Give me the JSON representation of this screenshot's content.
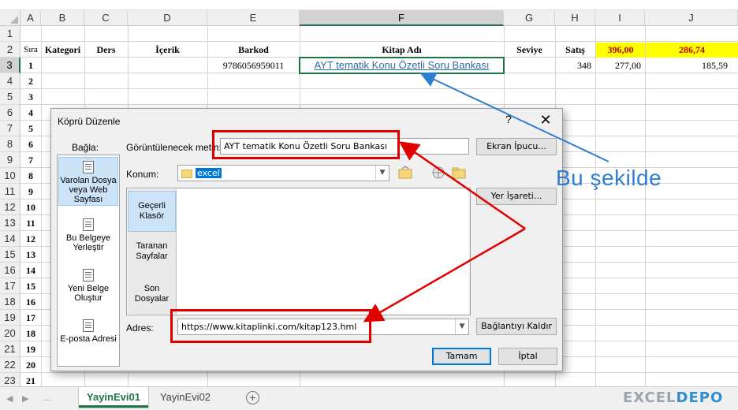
{
  "columns": [
    "A",
    "B",
    "C",
    "D",
    "E",
    "F",
    "G",
    "H",
    "I",
    "J"
  ],
  "selected_column": "F",
  "rows": [
    "1",
    "2",
    "3",
    "4",
    "5",
    "6",
    "7",
    "8",
    "9",
    "10",
    "11",
    "12",
    "13",
    "14",
    "15",
    "16",
    "17",
    "18",
    "19",
    "20",
    "21",
    "22",
    "23"
  ],
  "selected_row": "3",
  "header_row": {
    "sira": "Sıra",
    "kategori": "Kategori",
    "ders": "Ders",
    "icerik": "İçerik",
    "barkod": "Barkod",
    "kitap_adi": "Kitap Adı",
    "seviye": "Seviye",
    "satis": "Satış",
    "i_total": "396,00",
    "j_total": "286,74"
  },
  "data_row": {
    "sira": "1",
    "barkod": "9786056959011",
    "kitap_adi": "AYT tematik Konu Özetli Soru Bankası",
    "satis": "348",
    "i_value": "277,00",
    "j_value": "185,59"
  },
  "row_numbers": [
    "2",
    "3",
    "4",
    "5",
    "6",
    "7",
    "8",
    "9",
    "10",
    "11",
    "12",
    "13",
    "14",
    "15",
    "16",
    "17",
    "18",
    "19",
    "20",
    "21"
  ],
  "dialog": {
    "title": "Köprü Düzenle",
    "help": "?",
    "close": "✕",
    "bagla_label": "Bağla:",
    "link_items": [
      {
        "label": "Varolan Dosya veya Web Sayfası",
        "icon": "web-page-icon"
      },
      {
        "label": "Bu Belgeye Yerleştir",
        "icon": "document-place-icon"
      },
      {
        "label": "Yeni Belge Oluştur",
        "icon": "new-document-icon"
      },
      {
        "label": "E-posta Adresi",
        "icon": "email-icon"
      }
    ],
    "display_text_label": "Görüntülenecek metin:",
    "display_text_value": "AYT tematik Konu Özetli Soru Bankası",
    "screentip_button": "Ekran İpucu...",
    "location_label": "Konum:",
    "location_value": "excel",
    "bookmark_button": "Yer İşareti...",
    "side_nav": [
      "Geçerli Klasör",
      "Taranan Sayfalar",
      "Son Dosyalar"
    ],
    "address_label": "Adres:",
    "address_value": "https://www.kitaplinki.com/kitap123.hml",
    "remove_link_button": "Bağlantıyı Kaldır",
    "ok_button": "Tamam",
    "cancel_button": "İptal"
  },
  "annotation_text": "Bu şekilde",
  "sheet_tabs": [
    "YayinEvi01",
    "YayinEvi02"
  ],
  "active_tab": "YayinEvi01",
  "brand": {
    "part1": "EXCEL",
    "part2": "DEPO"
  },
  "colors": {
    "excel_green": "#217346",
    "annotation_red": "#e00000",
    "annotation_blue": "#2e7fd0",
    "total_yellow": "#ffff00"
  }
}
